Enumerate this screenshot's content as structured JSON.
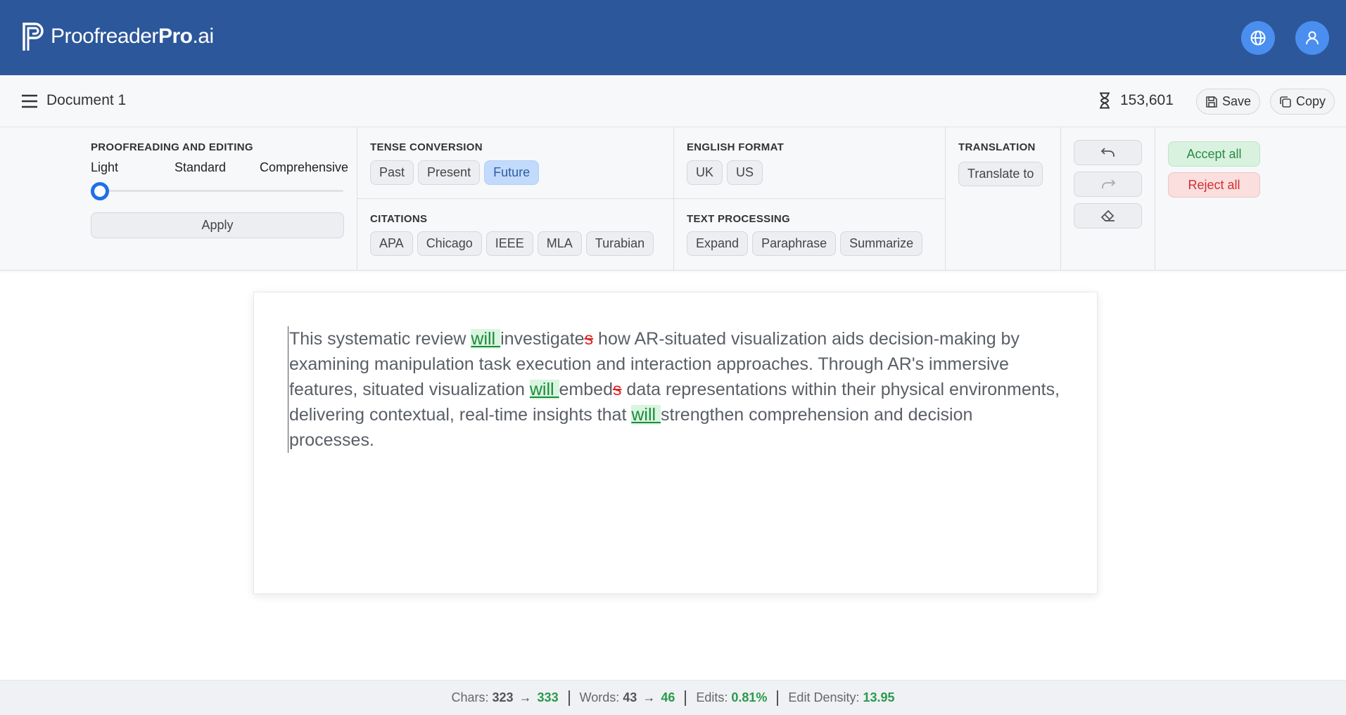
{
  "brand": {
    "name_light": "Proofreader",
    "name_bold": "Pro",
    "name_suffix": ".ai"
  },
  "header": {
    "language_icon": "globe-icon",
    "account_icon": "user-icon"
  },
  "docbar": {
    "title": "Document 1",
    "credits": "153,601",
    "save_label": "Save",
    "copy_label": "Copy"
  },
  "toolbar": {
    "proofreading": {
      "title": "PROOFREADING AND EDITING",
      "levels": [
        "Light",
        "Standard",
        "Comprehensive"
      ],
      "selected_level": "Light",
      "apply_label": "Apply"
    },
    "tense": {
      "title": "TENSE CONVERSION",
      "options": [
        "Past",
        "Present",
        "Future"
      ],
      "selected": "Future"
    },
    "citations": {
      "title": "CITATIONS",
      "options": [
        "APA",
        "Chicago",
        "IEEE",
        "MLA",
        "Turabian"
      ]
    },
    "english_format": {
      "title": "ENGLISH FORMAT",
      "options": [
        "UK",
        "US"
      ]
    },
    "text_processing": {
      "title": "TEXT PROCESSING",
      "options": [
        "Expand",
        "Paraphrase",
        "Summarize"
      ]
    },
    "translation": {
      "title": "TRANSLATION",
      "button_label": "Translate to"
    },
    "history": {
      "undo_icon": "undo-icon",
      "redo_icon": "redo-icon",
      "clear_icon": "eraser-icon"
    },
    "review": {
      "accept_label": "Accept all",
      "reject_label": "Reject all"
    }
  },
  "editor": {
    "segments": [
      {
        "t": "This systematic review "
      },
      {
        "t": "will ",
        "k": "ins"
      },
      {
        "t": "investigate"
      },
      {
        "t": "s",
        "k": "del"
      },
      {
        "t": " how AR-situated visualization aids decision-making by examining manipulation task execution and interaction approaches. Through AR's immersive features, situated visualization "
      },
      {
        "t": "will ",
        "k": "ins"
      },
      {
        "t": "embed"
      },
      {
        "t": "s",
        "k": "del"
      },
      {
        "t": " data representations within their physical environments, delivering contextual, real-time insights that "
      },
      {
        "t": "will ",
        "k": "ins"
      },
      {
        "t": "strengthen comprehension and decision processes."
      },
      {
        "t": " ",
        "k": "del"
      }
    ]
  },
  "status": {
    "chars_label": "Chars:",
    "chars_before": "323",
    "chars_after": "333",
    "words_label": "Words:",
    "words_before": "43",
    "words_after": "46",
    "edits_label": "Edits:",
    "edits_value": "0.81%",
    "density_label": "Edit Density:",
    "density_value": "13.95"
  },
  "colors": {
    "header": "#2c579a",
    "accent": "#1f6fe8",
    "insert": "#1e8a3a",
    "delete": "#e02020"
  }
}
